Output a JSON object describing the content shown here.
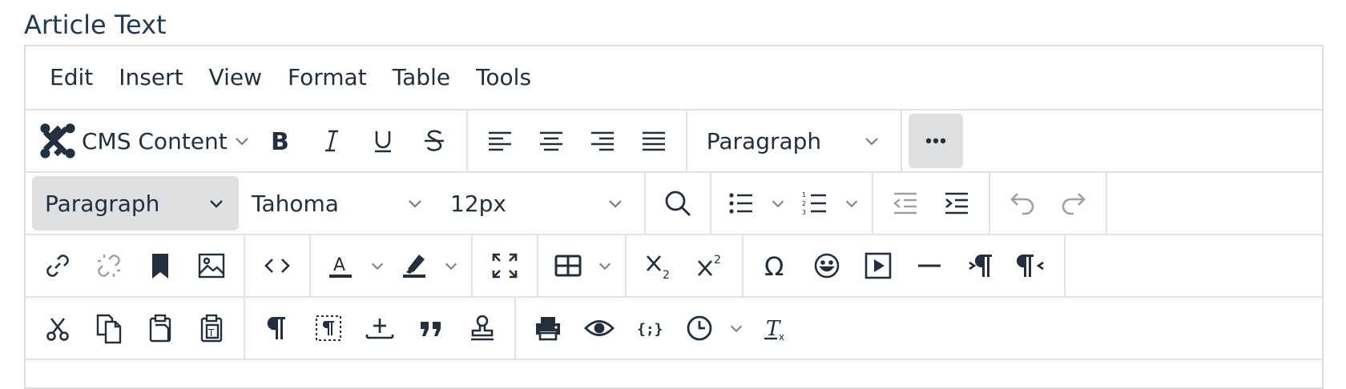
{
  "field_label": "Article Text",
  "menu": [
    "Edit",
    "Insert",
    "View",
    "Format",
    "Table",
    "Tools"
  ],
  "toolbar1": {
    "cms_content_label": "CMS Content",
    "blocks_select": "Paragraph"
  },
  "toolbar2": {
    "format_select": "Paragraph",
    "font_family": "Tahoma",
    "font_size": "12px"
  },
  "colors": {
    "text": "#222f3e",
    "border": "#e3e3e3",
    "active_bg": "#dee0e2",
    "label": "#1f3b5c",
    "disabled": "#9aa0a6"
  }
}
